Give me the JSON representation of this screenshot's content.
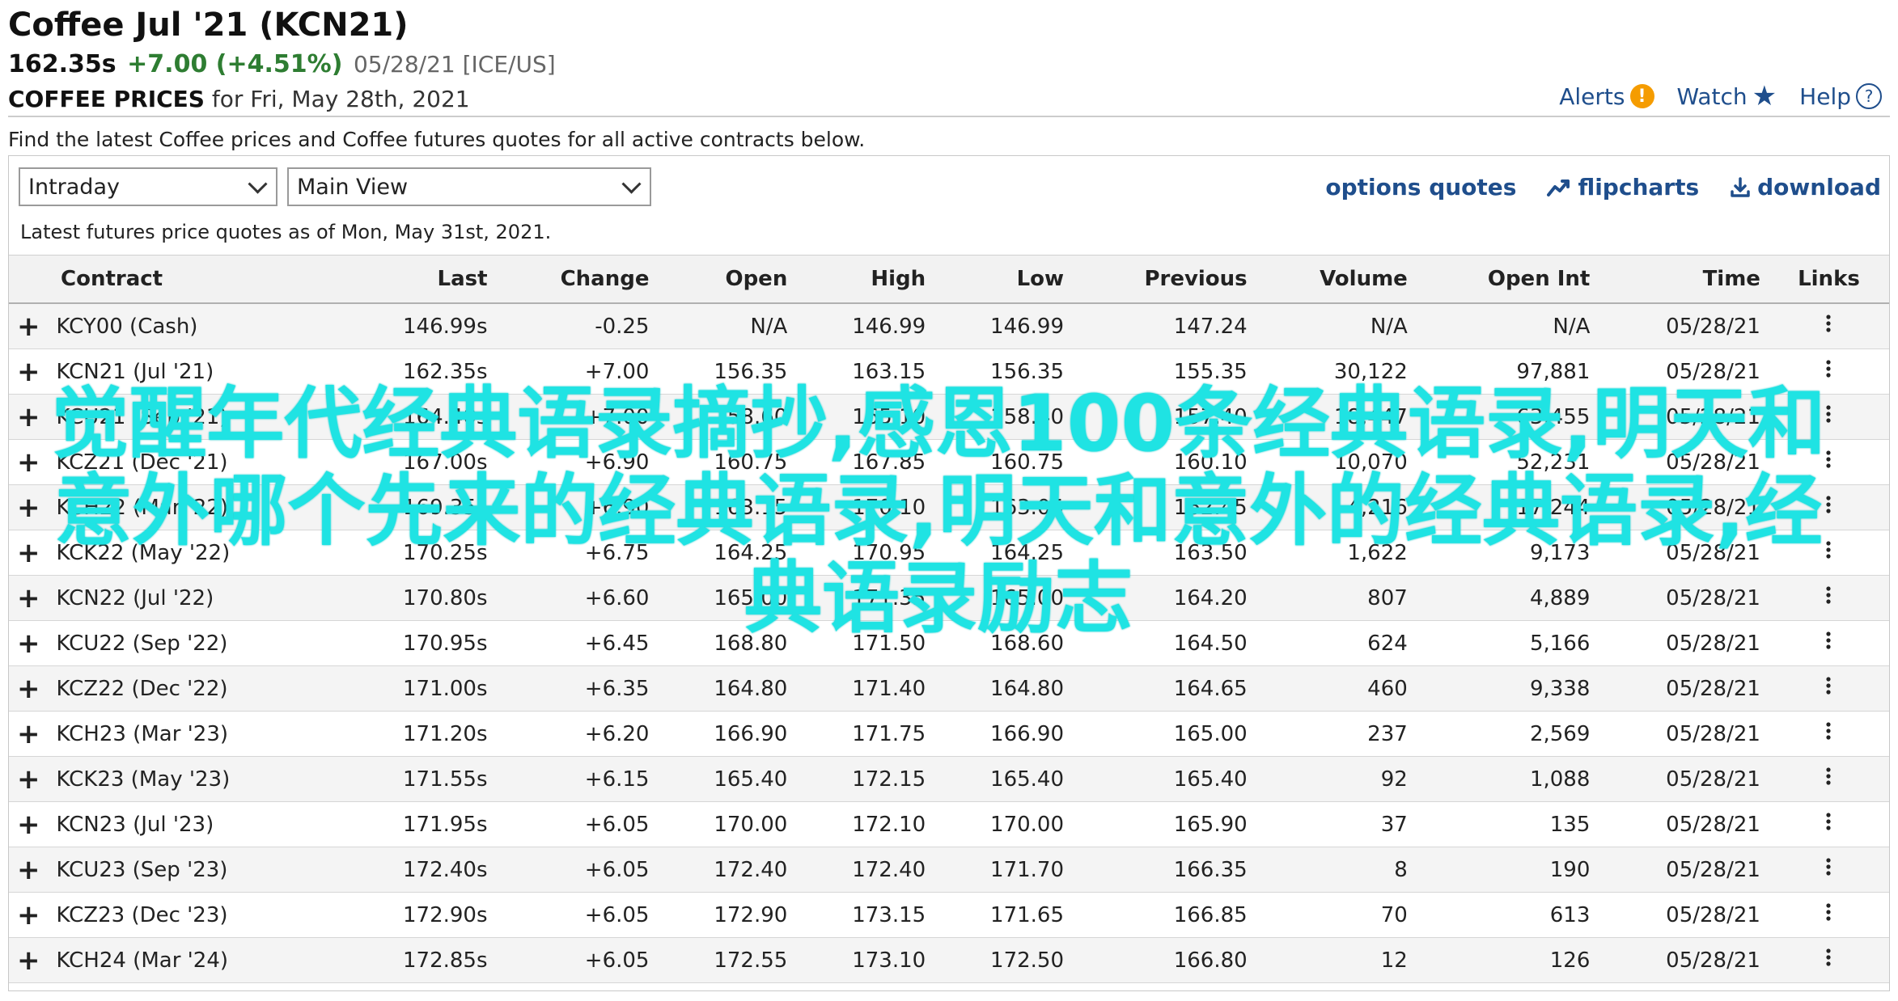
{
  "header": {
    "title": "Coffee Jul '21 (KCN21)",
    "last": "162.35s",
    "change": "+7.00 (+4.51%)",
    "date_exchange": "05/28/21 [ICE/US]",
    "prices_label": "COFFEE PRICES",
    "prices_for": "for Fri, May 28th, 2021",
    "alerts": "Alerts",
    "watch": "Watch",
    "help": "Help",
    "alert_glyph": "!",
    "help_glyph": "?"
  },
  "intro_text": "Find the latest Coffee prices and Coffee futures quotes for all active contracts below.",
  "controls": {
    "period_select": "Intraday",
    "view_select": "Main View",
    "options_quotes": "options quotes",
    "flipcharts": "flipcharts",
    "download": "download",
    "latest_text": "Latest futures price quotes as of Mon, May 31st, 2021."
  },
  "table": {
    "columns": [
      "Contract",
      "Last",
      "Change",
      "Open",
      "High",
      "Low",
      "Previous",
      "Volume",
      "Open Int",
      "Time",
      "Links"
    ],
    "rows": [
      {
        "contract": "KCY00 (Cash)",
        "last": "146.99s",
        "change": "-0.25",
        "open": "N/A",
        "high": "146.99",
        "low": "146.99",
        "previous": "147.24",
        "volume": "N/A",
        "open_int": "N/A",
        "time": "05/28/21"
      },
      {
        "contract": "KCN21 (Jul '21)",
        "last": "162.35s",
        "change": "+7.00",
        "open": "156.35",
        "high": "163.15",
        "low": "156.35",
        "previous": "155.35",
        "volume": "30,122",
        "open_int": "97,881",
        "time": "05/28/21"
      },
      {
        "contract": "KCU21 (Sep '21)",
        "last": "164.40s",
        "change": "+7.00",
        "open": "158.60",
        "high": "165.10",
        "low": "158.40",
        "previous": "157.40",
        "volume": "18,447",
        "open_int": "63,455",
        "time": "05/28/21"
      },
      {
        "contract": "KCZ21 (Dec '21)",
        "last": "167.00s",
        "change": "+6.90",
        "open": "160.75",
        "high": "167.85",
        "low": "160.75",
        "previous": "160.10",
        "volume": "10,070",
        "open_int": "52,231",
        "time": "05/28/21"
      },
      {
        "contract": "KCH22 (Mar '22)",
        "last": "169.35s",
        "change": "+6.90",
        "open": "163.15",
        "high": "170.10",
        "low": "163.05",
        "previous": "162.45",
        "volume": "4,216",
        "open_int": "17,244",
        "time": "05/28/21"
      },
      {
        "contract": "KCK22 (May '22)",
        "last": "170.25s",
        "change": "+6.75",
        "open": "164.25",
        "high": "170.95",
        "low": "164.25",
        "previous": "163.50",
        "volume": "1,622",
        "open_int": "9,173",
        "time": "05/28/21"
      },
      {
        "contract": "KCN22 (Jul '22)",
        "last": "170.80s",
        "change": "+6.60",
        "open": "165.00",
        "high": "171.35",
        "low": "165.00",
        "previous": "164.20",
        "volume": "807",
        "open_int": "4,889",
        "time": "05/28/21"
      },
      {
        "contract": "KCU22 (Sep '22)",
        "last": "170.95s",
        "change": "+6.45",
        "open": "168.80",
        "high": "171.50",
        "low": "168.60",
        "previous": "164.50",
        "volume": "624",
        "open_int": "5,166",
        "time": "05/28/21"
      },
      {
        "contract": "KCZ22 (Dec '22)",
        "last": "171.00s",
        "change": "+6.35",
        "open": "164.80",
        "high": "171.40",
        "low": "164.80",
        "previous": "164.65",
        "volume": "460",
        "open_int": "9,338",
        "time": "05/28/21"
      },
      {
        "contract": "KCH23 (Mar '23)",
        "last": "171.20s",
        "change": "+6.20",
        "open": "166.90",
        "high": "171.75",
        "low": "166.90",
        "previous": "165.00",
        "volume": "237",
        "open_int": "2,569",
        "time": "05/28/21"
      },
      {
        "contract": "KCK23 (May '23)",
        "last": "171.55s",
        "change": "+6.15",
        "open": "165.40",
        "high": "172.15",
        "low": "165.40",
        "previous": "165.40",
        "volume": "92",
        "open_int": "1,088",
        "time": "05/28/21"
      },
      {
        "contract": "KCN23 (Jul '23)",
        "last": "171.95s",
        "change": "+6.05",
        "open": "170.00",
        "high": "172.10",
        "low": "170.00",
        "previous": "165.90",
        "volume": "37",
        "open_int": "135",
        "time": "05/28/21"
      },
      {
        "contract": "KCU23 (Sep '23)",
        "last": "172.40s",
        "change": "+6.05",
        "open": "172.40",
        "high": "172.40",
        "low": "171.70",
        "previous": "166.35",
        "volume": "8",
        "open_int": "190",
        "time": "05/28/21"
      },
      {
        "contract": "KCZ23 (Dec '23)",
        "last": "172.90s",
        "change": "+6.05",
        "open": "172.90",
        "high": "173.15",
        "low": "171.65",
        "previous": "166.85",
        "volume": "70",
        "open_int": "613",
        "time": "05/28/21"
      },
      {
        "contract": "KCH24 (Mar '24)",
        "last": "172.85s",
        "change": "+6.05",
        "open": "172.55",
        "high": "173.10",
        "low": "172.50",
        "previous": "166.80",
        "volume": "12",
        "open_int": "126",
        "time": "05/28/21"
      }
    ]
  },
  "watermark": "觉醒年代经典语录摘抄,感恩100条经典语录,明天和意外哪个先来的经典语录,明天和意外的经典语录,经典语录励志",
  "icons": {
    "expand": "plus-icon",
    "links": "kebab-menu-icon",
    "alerts": "alert-icon",
    "watch": "star-icon",
    "help": "help-icon",
    "flipcharts": "chart-trend-icon",
    "download": "download-icon",
    "select": "chevron-down-icon"
  },
  "colors": {
    "link": "#1f4e8c",
    "positive": "#2e7d32",
    "negative": "#d32f2f",
    "watermark": "#1fe3e3",
    "alert": "#f59c00"
  }
}
